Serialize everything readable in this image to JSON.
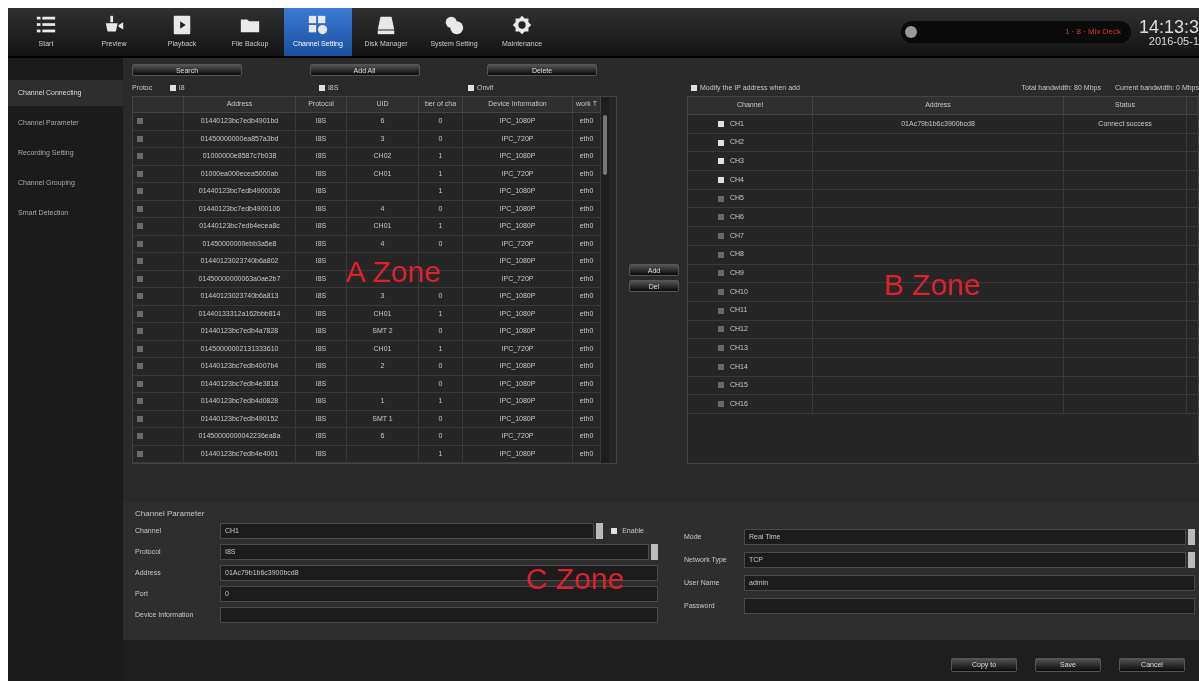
{
  "nav": [
    {
      "label": "Start",
      "selected": false
    },
    {
      "label": "Preview",
      "selected": false
    },
    {
      "label": "Playback",
      "selected": false
    },
    {
      "label": "File Backup",
      "selected": false
    },
    {
      "label": "Channel Setting",
      "selected": true
    },
    {
      "label": "Disk Manager",
      "selected": false
    },
    {
      "label": "System Setting",
      "selected": false
    },
    {
      "label": "Maintenance",
      "selected": false
    }
  ],
  "status": {
    "text": "1 · 8 · Mix Deck",
    "time": "14:13:3",
    "date": "2016-05-1"
  },
  "sidebar": [
    {
      "label": "Channel Connecting",
      "selected": true
    },
    {
      "label": "Channel Parameter",
      "selected": false
    },
    {
      "label": "Recording Setting",
      "selected": false
    },
    {
      "label": "Channel Grouping",
      "selected": false
    },
    {
      "label": "Smart Detection",
      "selected": false
    }
  ],
  "search_buttons": [
    "Search",
    "Add All",
    "Delete"
  ],
  "protocol_filter": {
    "label": "Protoc",
    "options": [
      {
        "label": "I8",
        "checked": true
      },
      {
        "label": "I8S",
        "checked": true
      },
      {
        "label": "Onvif",
        "checked": true
      }
    ]
  },
  "device_table": {
    "columns": [
      "Address",
      "Protocol",
      "UID",
      "ber of cha",
      "Device Information",
      "work T"
    ],
    "rows": [
      {
        "checked": false,
        "cells": [
          "01440123bc7edb4901bd",
          "I8S",
          "6",
          "0",
          "IPC_1080P",
          "eth0"
        ]
      },
      {
        "checked": false,
        "cells": [
          "01450000000ea857a3bd",
          "I8S",
          "3",
          "0",
          "IPC_720P",
          "eth0"
        ]
      },
      {
        "checked": false,
        "cells": [
          "01000000e8587c7b038",
          "I8S",
          "CH02",
          "1",
          "IPC_1080P",
          "eth0"
        ]
      },
      {
        "checked": false,
        "cells": [
          "01000ea000ecea5000ab",
          "I8S",
          "CH01",
          "1",
          "IPC_720P",
          "eth0"
        ]
      },
      {
        "checked": false,
        "cells": [
          "01440123bc7edb4900036",
          "I8S",
          null,
          "1",
          "IPC_1080P",
          "eth0"
        ]
      },
      {
        "checked": false,
        "cells": [
          "01440123bc7edb4900106",
          "I8S",
          "4",
          "0",
          "IPC_1080P",
          "eth0"
        ]
      },
      {
        "checked": false,
        "cells": [
          "01440123bc7edb4ecea8c",
          "I8S",
          "CH01",
          "1",
          "IPC_1080P",
          "eth0"
        ]
      },
      {
        "checked": false,
        "cells": [
          "01450000000ebb3a5e8",
          "I8S",
          "4",
          "0",
          "IPC_720P",
          "eth0"
        ]
      },
      {
        "checked": false,
        "cells": [
          "01440123023740b6a802",
          "I8S",
          null,
          null,
          "IPC_1080P",
          "eth0"
        ]
      },
      {
        "checked": false,
        "cells": [
          "01450000000063a0ae2b7",
          "I8S",
          null,
          null,
          "IPC_720P",
          "eth0"
        ]
      },
      {
        "checked": false,
        "cells": [
          "01440123023740b6a813",
          "I8S",
          "3",
          "0",
          "IPC_1080P",
          "eth0"
        ]
      },
      {
        "checked": false,
        "cells": [
          "01440133312a162bbb814",
          "I8S",
          "CH01",
          "1",
          "IPC_1080P",
          "eth0"
        ]
      },
      {
        "checked": false,
        "cells": [
          "01440123bc7edb4a7828",
          "I8S",
          "SMT 2",
          "0",
          "IPC_1080P",
          "eth0"
        ]
      },
      {
        "checked": false,
        "cells": [
          "01450000002131333610",
          "I8S",
          "CH01",
          "1",
          "IPC_720P",
          "eth0"
        ]
      },
      {
        "checked": false,
        "cells": [
          "01440123bc7edb4007b4",
          "I8S",
          "2",
          "0",
          "IPC_1080P",
          "eth0"
        ]
      },
      {
        "checked": false,
        "cells": [
          "01440123bc7edb4e3818",
          "I8S",
          null,
          "0",
          "IPC_1080P",
          "eth0"
        ]
      },
      {
        "checked": false,
        "cells": [
          "01440123bc7edb4d0828",
          "I8S",
          "1",
          "1",
          "IPC_1080P",
          "eth0"
        ]
      },
      {
        "checked": false,
        "cells": [
          "01440123bc7edb490152",
          "I8S",
          "SMT 1",
          "0",
          "IPC_1080P",
          "eth0"
        ]
      },
      {
        "checked": false,
        "cells": [
          "01450000000042236ea8a",
          "I8S",
          "6",
          "0",
          "IPC_720P",
          "eth0"
        ]
      },
      {
        "checked": false,
        "cells": [
          "01440123bc7edb4e4001",
          "I8S",
          null,
          "1",
          "IPC_1080P",
          "eth0"
        ]
      }
    ]
  },
  "move_buttons": [
    "Add",
    "Del"
  ],
  "modify_ip": {
    "label": "Modify the IP address when add",
    "checked": true
  },
  "total_bandwidth": "Total bandwidth: 80 Mbps",
  "current_bandwidth": "Current bandwidth: 0 Mbps",
  "channel_table": {
    "columns": [
      "Channel",
      "Address",
      "Status"
    ],
    "rows": [
      {
        "checked": true,
        "cells": [
          "CH1",
          "01Ac79b1b6c3900bcd8",
          "Connect success"
        ]
      },
      {
        "checked": true,
        "cells": [
          "CH2"
        ]
      },
      {
        "checked": true,
        "cells": [
          "CH3"
        ]
      },
      {
        "checked": true,
        "cells": [
          "CH4"
        ]
      },
      {
        "checked": false,
        "cells": [
          "CH5"
        ]
      },
      {
        "checked": false,
        "cells": [
          "CH6"
        ]
      },
      {
        "checked": false,
        "cells": [
          "CH7"
        ]
      },
      {
        "checked": false,
        "cells": [
          "CH8"
        ]
      },
      {
        "checked": false,
        "cells": [
          "CH9"
        ]
      },
      {
        "checked": false,
        "cells": [
          "CH10"
        ]
      },
      {
        "checked": false,
        "cells": [
          "CH11"
        ]
      },
      {
        "checked": false,
        "cells": [
          "CH12"
        ]
      },
      {
        "checked": false,
        "cells": [
          "CH13"
        ]
      },
      {
        "checked": false,
        "cells": [
          "CH14"
        ]
      },
      {
        "checked": false,
        "cells": [
          "CH15"
        ]
      },
      {
        "checked": false,
        "cells": [
          "CH16"
        ]
      }
    ]
  },
  "parameters": {
    "title": "Channel Parameter",
    "left": [
      {
        "label": "Channel",
        "kind": "select",
        "value": "CH1"
      },
      {
        "label": "Protocol",
        "kind": "select",
        "value": "I8S"
      },
      {
        "label": "Address",
        "kind": "text",
        "value": "01Ac79b1b6c3900bcd8"
      },
      {
        "label": "Port",
        "kind": "text",
        "value": "0"
      },
      {
        "label": "Device Information",
        "kind": "text"
      }
    ],
    "enable": {
      "label": "Enable",
      "checked": true
    },
    "right": [
      {
        "label": "Mode",
        "kind": "select",
        "value": "Real Time"
      },
      {
        "label": "Network Type",
        "kind": "select",
        "value": "TCP"
      },
      {
        "label": "User Name",
        "kind": "text",
        "value": "admin"
      },
      {
        "label": "Password",
        "kind": "text"
      }
    ]
  },
  "footer_buttons": [
    "Copy to",
    "Save",
    "Cancel"
  ],
  "zone_labels": [
    "A Zone",
    "B Zone",
    "C Zone"
  ]
}
